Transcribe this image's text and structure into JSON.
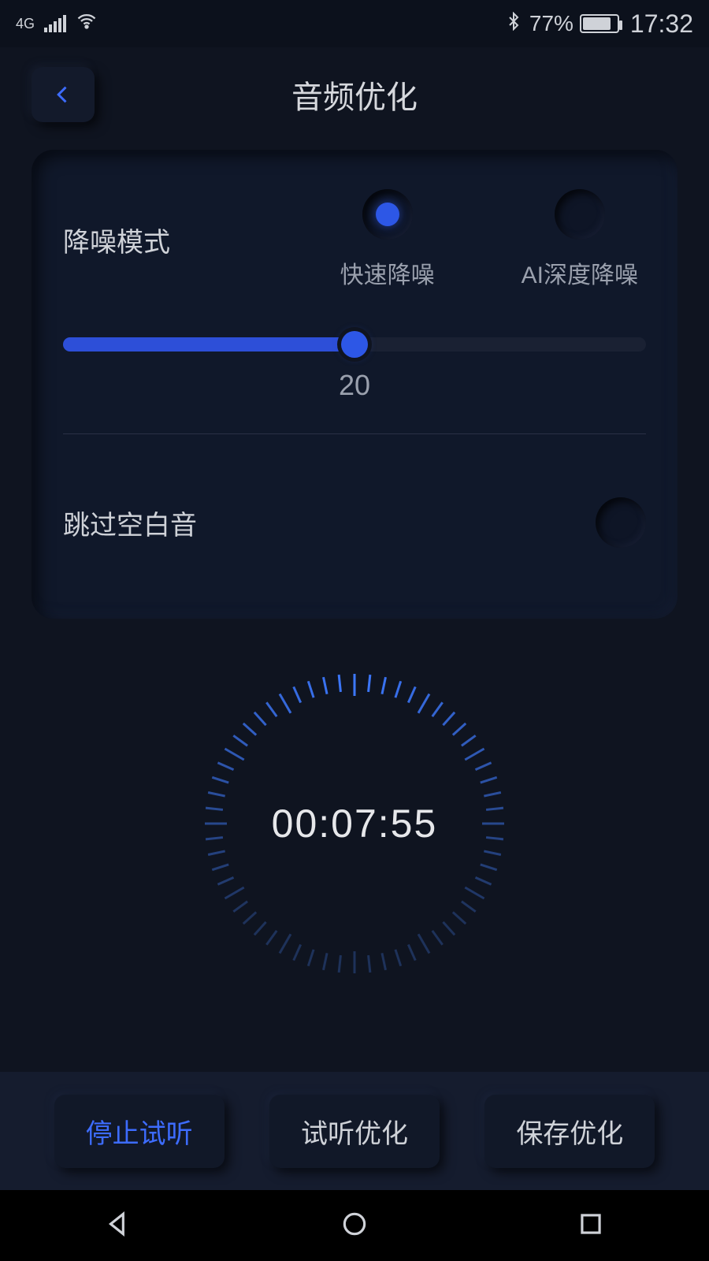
{
  "status": {
    "network": "4G",
    "battery_pct": "77%",
    "battery_fill_pct": 77,
    "time": "17:32"
  },
  "header": {
    "title": "音频优化"
  },
  "noise": {
    "label": "降噪模式",
    "options": {
      "fast": "快速降噪",
      "ai": "AI深度降噪"
    },
    "selected": "fast",
    "slider_value": "20",
    "slider_percent": 50
  },
  "skip": {
    "label": "跳过空白音",
    "enabled": false
  },
  "timer": {
    "text": "00:07:55"
  },
  "actions": {
    "stop": "停止试听",
    "preview": "试听优化",
    "save": "保存优化"
  }
}
